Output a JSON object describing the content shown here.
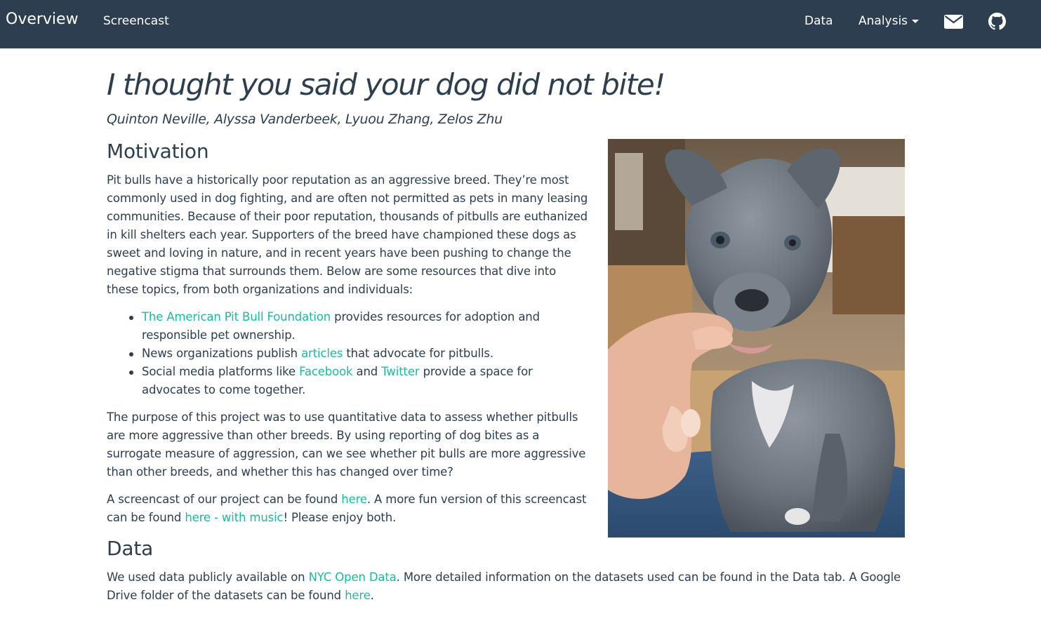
{
  "navbar": {
    "brand": "Overview",
    "links": [
      "Screencast",
      "Data",
      "Analysis"
    ],
    "icons": [
      "envelope-icon",
      "github-icon"
    ],
    "colors": {
      "background": "#2c3e50",
      "text": "#ffffff",
      "link": "#18bc9c"
    }
  },
  "page": {
    "title": "I thought you said your dog did not bite!",
    "authors": "Quinton Neville, Alyssa Vanderbeek, Lyuou Zhang, Zelos Zhu",
    "motivation": {
      "heading": "Motivation",
      "p1": "Pit bulls have a historically poor reputation as an aggressive breed. They’re most commonly used in dog fighting, and are often not permitted as pets in many leasing communities. Because of their poor reputation, thousands of pitbulls are euthanized in kill shelters each year. Supporters of the breed have championed these dogs as sweet and loving in nature, and in recent years have been pushing to change the negative stigma that surrounds them. Below are some resources that dive into these topics, from both organizations and individuals:",
      "bullets": [
        {
          "link": "The American Pit Bull Foundation",
          "rest": " provides resources for adoption and responsible pet ownership."
        },
        {
          "pre": "News organizations publish ",
          "link": "articles",
          "rest": " that advocate for pitbulls."
        },
        {
          "pre": "Social media platforms like ",
          "link1": "Facebook",
          "mid": " and ",
          "link2": "Twitter",
          "rest": " provide a space for advocates to come together."
        }
      ],
      "p2": "The purpose of this project was to use quantitative data to assess whether pitbulls are more aggressive than other breeds. By using reporting of dog bites as a surrogate measure of aggression, can we see whether pit bulls are more aggressive than other breeds, and whether this has changed over time?",
      "p3": {
        "pre": "A screencast of our project can be found ",
        "link1": "here",
        "mid": ". A more fun version of this screencast can be found ",
        "link2": "here - with music",
        "post": "! Please enjoy both."
      }
    },
    "data_section": {
      "heading": "Data",
      "pre": "We used data publicly available on ",
      "link1": "NYC Open Data",
      "mid": ". More detailed information on the datasets used can be found in the Data tab. A Google Drive folder of the datasets can be found ",
      "link2": "here",
      "post": "."
    },
    "image": {
      "subject": "grey pitbull puppy mouthing a finger"
    }
  }
}
